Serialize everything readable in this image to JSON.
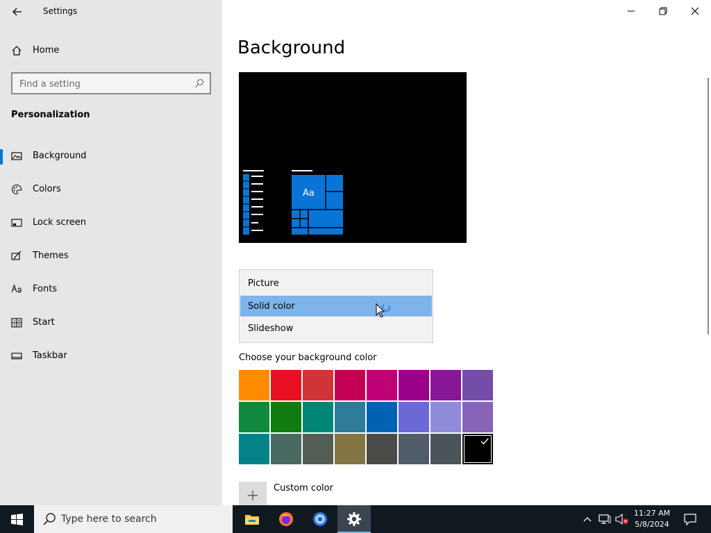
{
  "window": {
    "title": "Settings"
  },
  "sidebar": {
    "home_label": "Home",
    "search_placeholder": "Find a setting",
    "section_title": "Personalization",
    "items": [
      {
        "label": "Background",
        "icon": "picture-icon",
        "active": true
      },
      {
        "label": "Colors",
        "icon": "palette-icon",
        "active": false
      },
      {
        "label": "Lock screen",
        "icon": "lock-screen-icon",
        "active": false
      },
      {
        "label": "Themes",
        "icon": "themes-icon",
        "active": false
      },
      {
        "label": "Fonts",
        "icon": "fonts-icon",
        "active": false
      },
      {
        "label": "Start",
        "icon": "start-icon",
        "active": false
      },
      {
        "label": "Taskbar",
        "icon": "taskbar-icon",
        "active": false
      }
    ]
  },
  "main": {
    "page_title": "Background",
    "preview_tile_text": "Aa",
    "dropdown": {
      "options": [
        "Picture",
        "Solid color",
        "Slideshow"
      ],
      "selected": "Solid color"
    },
    "choose_color_label": "Choose your background color",
    "swatches": [
      [
        "#ff8c00",
        "#e81123",
        "#d13438",
        "#c30052",
        "#bf0077",
        "#9a0089",
        "#881798",
        "#744da9"
      ],
      [
        "#10893e",
        "#107c10",
        "#018574",
        "#2d7d9a",
        "#0063b1",
        "#6b69d6",
        "#8e8cd8",
        "#8764b8"
      ],
      [
        "#038387",
        "#486860",
        "#525e54",
        "#847545",
        "#4c4a48",
        "#515c6b",
        "#4a5459",
        "#000000"
      ]
    ],
    "selected_swatch": "#000000",
    "custom_color_label": "Custom color"
  },
  "taskbar": {
    "search_placeholder": "Type here to search",
    "apps": [
      "file-explorer-icon",
      "firefox-icon",
      "chrome-icon",
      "settings-icon"
    ],
    "time": "11:27 AM",
    "date": "5/8/2024"
  },
  "colors": {
    "accent": "#0078d7",
    "selection": "#7eb4ea",
    "taskbar": "#101820"
  }
}
